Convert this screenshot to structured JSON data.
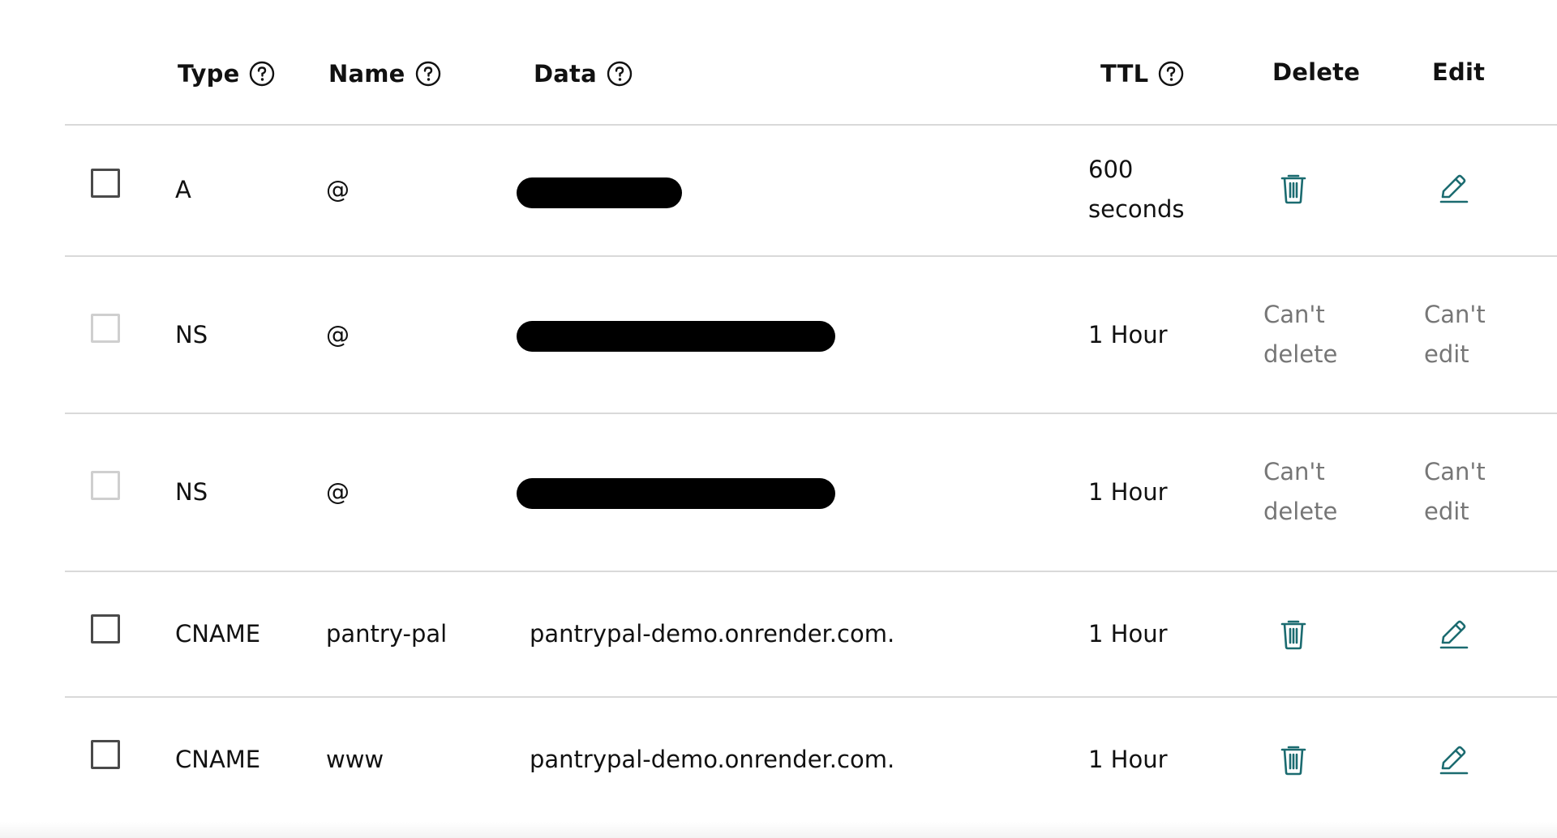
{
  "header": {
    "type": "Type",
    "name": "Name",
    "data": "Data",
    "ttl": "TTL",
    "delete": "Delete",
    "edit": "Edit"
  },
  "records": [
    {
      "type": "A",
      "name": "@",
      "data": "",
      "ttl_line1": "600",
      "ttl_line2": "seconds",
      "can_modify": true
    },
    {
      "type": "NS",
      "name": "@",
      "data": "",
      "ttl_line1": "1 Hour",
      "ttl_line2": "",
      "can_modify": false,
      "delete_line1": "Can't",
      "delete_line2": "delete",
      "edit_line1": "Can't",
      "edit_line2": "edit"
    },
    {
      "type": "NS",
      "name": "@",
      "data": "",
      "ttl_line1": "1 Hour",
      "ttl_line2": "",
      "can_modify": false,
      "delete_line1": "Can't",
      "delete_line2": "delete",
      "edit_line1": "Can't",
      "edit_line2": "edit"
    },
    {
      "type": "CNAME",
      "name": "pantry-pal",
      "data": "pantrypal-demo.onrender.com.",
      "ttl_line1": "1 Hour",
      "ttl_line2": "",
      "can_modify": true
    },
    {
      "type": "CNAME",
      "name": "www",
      "data": "pantrypal-demo.onrender.com.",
      "ttl_line1": "1 Hour",
      "ttl_line2": "",
      "can_modify": true
    }
  ],
  "icons": {
    "help": "question-circle-icon",
    "delete": "trash-icon",
    "edit": "pencil-icon"
  },
  "colors": {
    "action_icon": "#1b6b70",
    "muted_text": "#767676",
    "divider": "#d9d9d9"
  }
}
